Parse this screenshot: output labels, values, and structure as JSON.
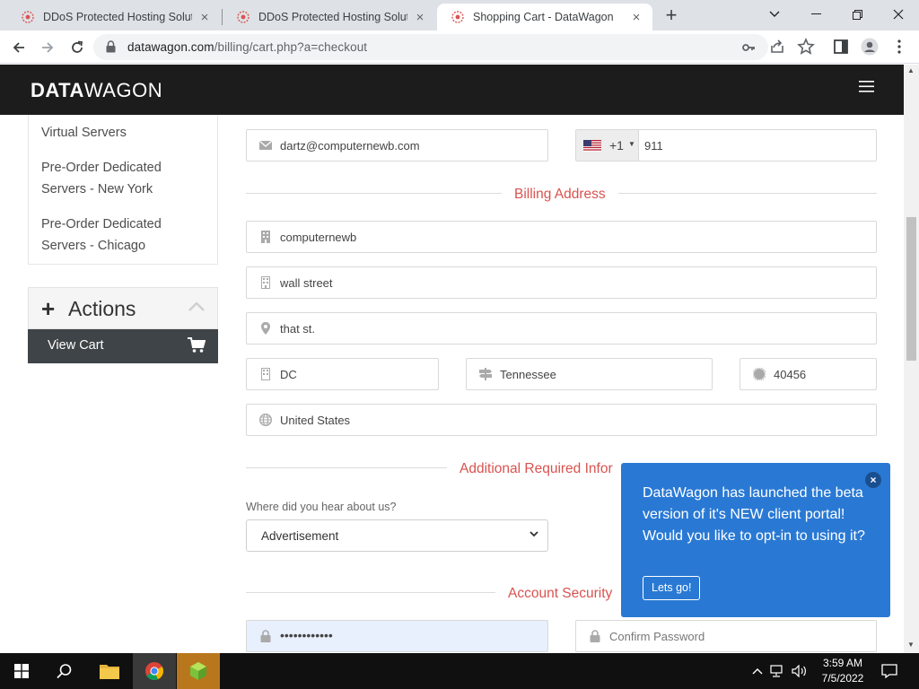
{
  "browser": {
    "tabs": [
      {
        "title": "DDoS Protected Hosting Solutio",
        "active": false
      },
      {
        "title": "DDoS Protected Hosting Solutio",
        "active": false
      },
      {
        "title": "Shopping Cart - DataWagon",
        "active": true
      }
    ],
    "url_host": "datawagon.com",
    "url_path": "/billing/cart.php?a=checkout"
  },
  "site": {
    "logo_bold": "DATA",
    "logo_light": "WAGON"
  },
  "sidebar": {
    "items": [
      {
        "label": "Virtual Servers"
      },
      {
        "label": "Pre-Order Dedicated Servers - New York"
      },
      {
        "label": "Pre-Order Dedicated Servers - Chicago"
      }
    ],
    "actions": {
      "title": "Actions",
      "view_cart": "View Cart"
    }
  },
  "form": {
    "email": "dartz@computernewb.com",
    "phone_code": "+1",
    "phone": "911",
    "billing_title": "Billing Address",
    "company": "computernewb",
    "address1": "wall street",
    "address2": "that st.",
    "city": "DC",
    "state": "Tennessee",
    "postcode": "40456",
    "country": "United States",
    "additional_title": "Additional Required Infor",
    "heard_label": "Where did you hear about us?",
    "heard_value": "Advertisement",
    "security_title": "Account Security",
    "password_dots": "••••••••••••",
    "confirm_placeholder": "Confirm Password"
  },
  "popup": {
    "message": "DataWagon has launched the beta version of it's NEW client portal! Would you like to opt-in to using it?",
    "button": "Lets go!",
    "close": "×"
  },
  "taskbar": {
    "time": "3:59 AM",
    "date": "7/5/2022"
  },
  "colors": {
    "accent_red": "#d9534f",
    "popup_blue": "#2979d4",
    "header_dark": "#1c1c1c"
  }
}
